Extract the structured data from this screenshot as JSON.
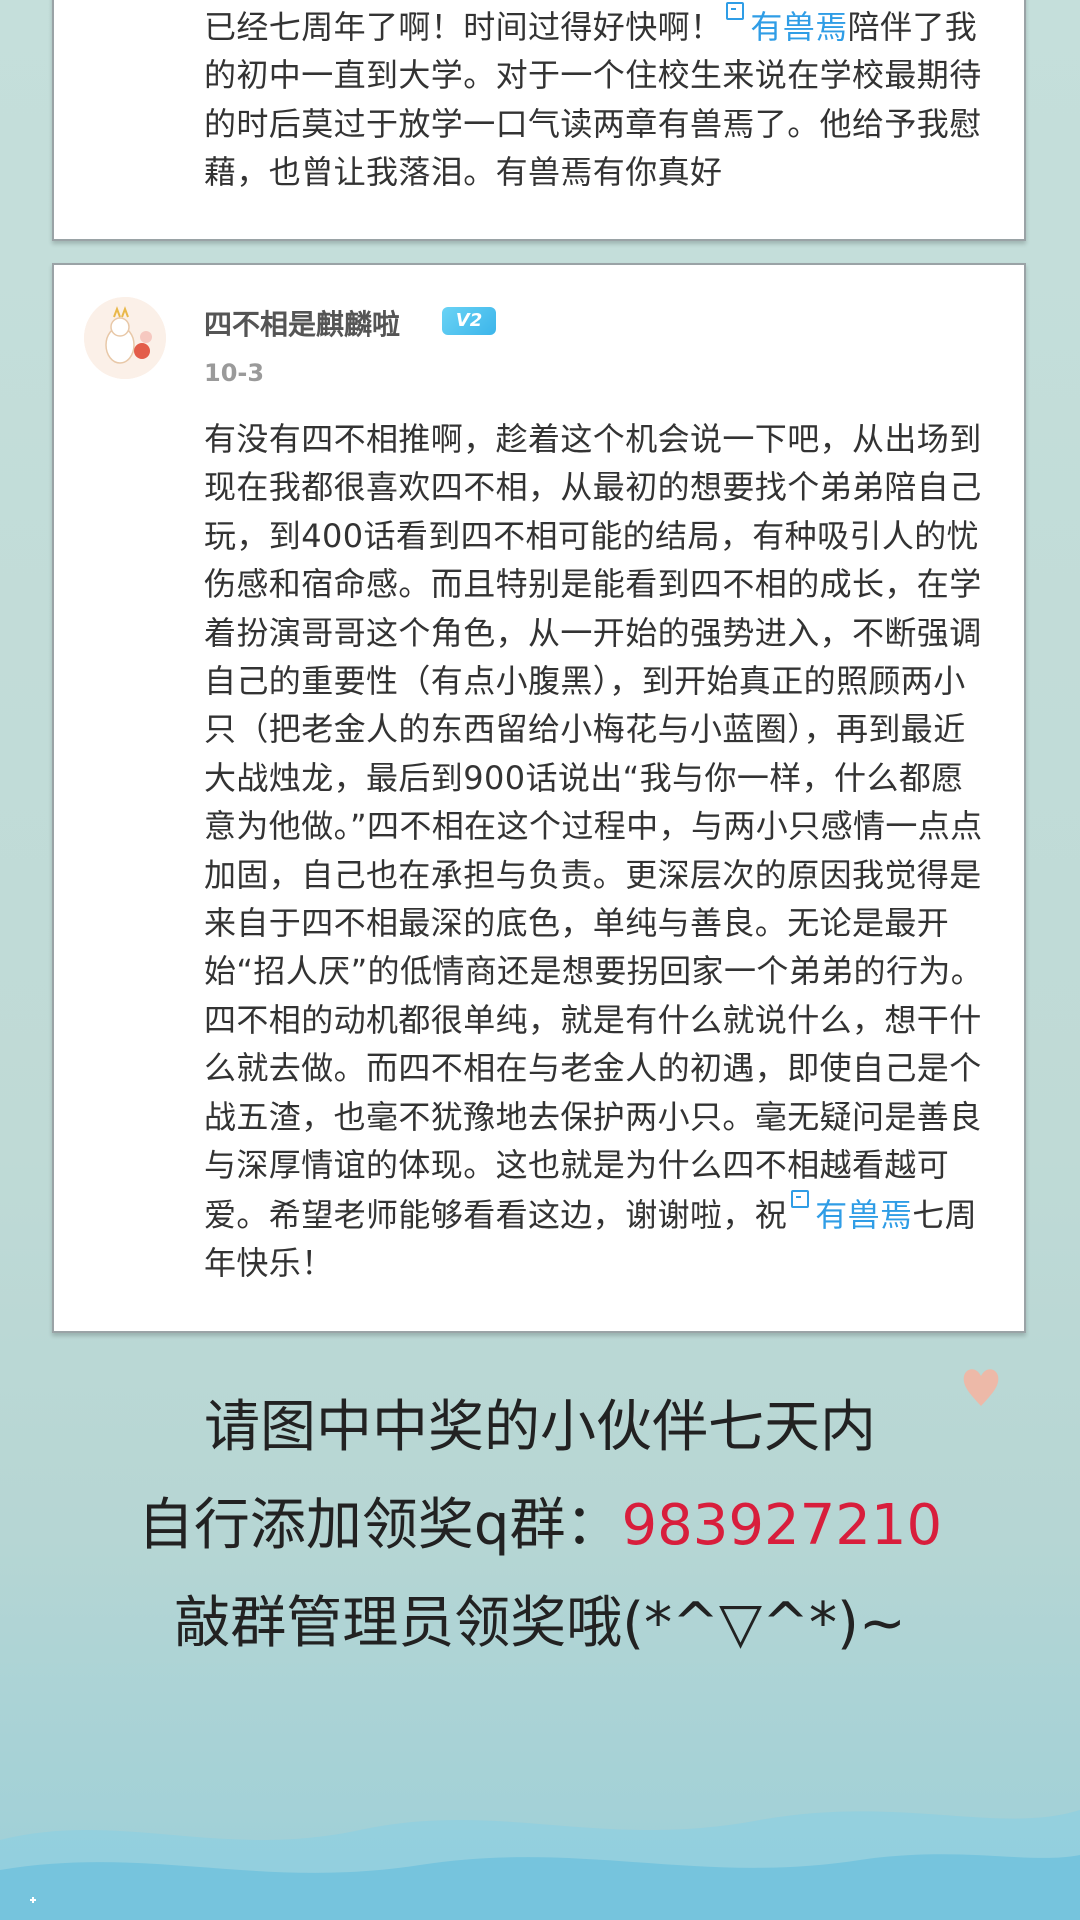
{
  "comments": [
    {
      "text_before": "已经七周年了啊！时间过得好快啊！",
      "topic": "有兽焉",
      "text_after": "陪伴了我的初中一直到大学。对于一个住校生来说在学校最期待的时后莫过于放学一口气读两章有兽焉了。他给予我慰藉，也曾让我落泪。有兽焉有你真好"
    },
    {
      "username": "四不相是麒麟啦",
      "level": "V2",
      "date": "10-3",
      "text_before": "有没有四不相推啊，趁着这个机会说一下吧，从出场到现在我都很喜欢四不相，从最初的想要找个弟弟陪自己玩，到400话看到四不相可能的结局，有种吸引人的忧伤感和宿命感。而且特别是能看到四不相的成长，在学着扮演哥哥这个角色，从一开始的强势进入，不断强调自己的重要性（有点小腹黑），到开始真正的照顾两小只（把老金人的东西留给小梅花与小蓝圈），再到最近大战烛龙，最后到900话说出“我与你一样，什么都愿意为他做。”四不相在这个过程中，与两小只感情一点点加固，自己也在承担与负责。更深层次的原因我觉得是来自于四不相最深的底色，单纯与善良。无论是最开始“招人厌”的低情商还是想要拐回家一个弟弟的行为。四不相的动机都很单纯，就是有什么就说什么，想干什么就去做。而四不相在与老金人的初遇，即使自己是个战五渣，也毫不犹豫地去保护两小只。毫无疑问是善良与深厚情谊的体现。这也就是为什么四不相越看越可爱。希望老师能够看看这边，谢谢啦，祝",
      "topic": "有兽焉",
      "text_after": "七周年快乐！"
    }
  ],
  "notice": {
    "line1": "请图中中奖的小伙伴七天内",
    "line2_prefix": "自行添加领奖q群：",
    "qq_group": "983927210",
    "line3": "敲群管理员领奖哦(*^▽^*)~"
  },
  "icons": {
    "topic": "topic-tag-icon",
    "heart": "heart-icon",
    "avatar": "avatar"
  },
  "colors": {
    "background": "#c2dcd8",
    "topic_link": "#2f9de6",
    "qq_number": "#d81e3c",
    "level_badge": "#3cb5ea"
  }
}
